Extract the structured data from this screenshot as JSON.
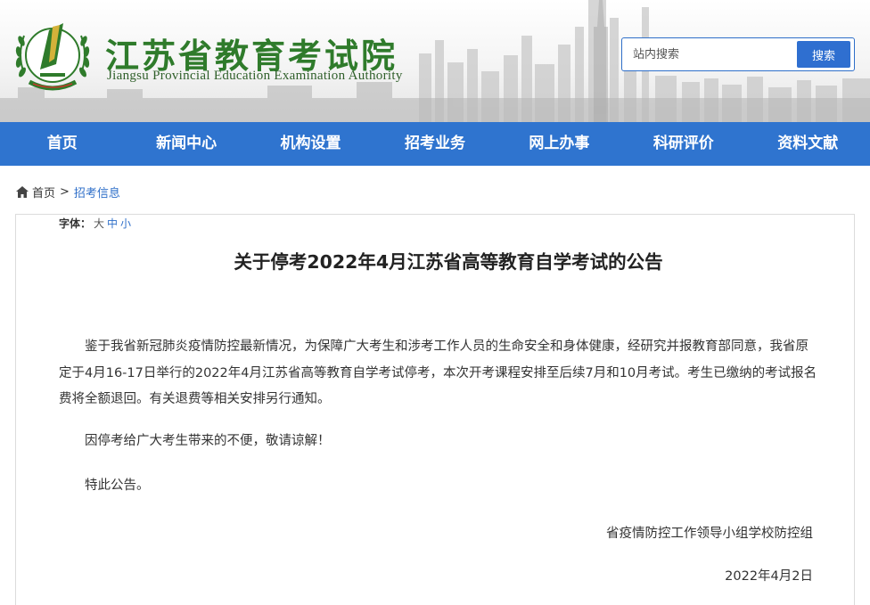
{
  "header": {
    "title": "江苏省教育考试院",
    "subtitle": "Jiangsu Provincial Education Examination Authority",
    "logo_icon": "jiangsu-exam-authority-emblem"
  },
  "search": {
    "placeholder": "站内搜索",
    "button_label": "搜索"
  },
  "nav": {
    "items": [
      {
        "label": "首页"
      },
      {
        "label": "新闻中心"
      },
      {
        "label": "机构设置"
      },
      {
        "label": "招考业务"
      },
      {
        "label": "网上办事"
      },
      {
        "label": "科研评价"
      },
      {
        "label": "资料文献"
      }
    ]
  },
  "breadcrumb": {
    "home_icon": "home-icon",
    "home_label": "首页",
    "separator": ">",
    "current_label": "招考信息"
  },
  "font_size": {
    "label": "字体：",
    "options": [
      "大",
      "中",
      "小"
    ]
  },
  "article": {
    "title": "关于停考2022年4月江苏省高等教育自学考试的公告",
    "paragraphs": [
      "鉴于我省新冠肺炎疫情防控最新情况，为保障广大考生和涉考工作人员的生命安全和身体健康，经研究并报教育部同意，我省原定于4月16-17日举行的2022年4月江苏省高等教育自学考试停考，本次开考课程安排至后续7月和10月考试。考生已缴纳的考试报名费将全额退回。有关退费等相关安排另行通知。",
      "因停考给广大考生带来的不便，敬请谅解！",
      "特此公告。"
    ],
    "signature_org": "省疫情防控工作领导小组学校防控组",
    "signature_date": "2022年4月2日"
  },
  "colors": {
    "nav_bg": "#2f74cf",
    "title_green": "#2f7b2b",
    "link_blue": "#2f6fc9"
  }
}
